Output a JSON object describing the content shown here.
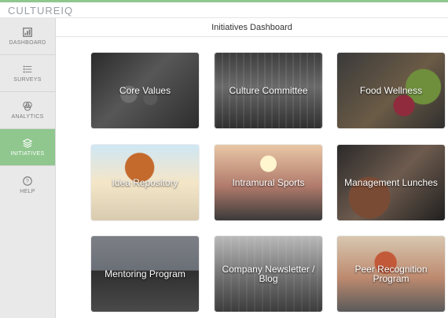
{
  "app": {
    "logo_text": "CULTUREIQ",
    "accent_color": "#8fc78f"
  },
  "sidebar": {
    "items": [
      {
        "label": "DASHBOARD",
        "icon": "dashboard-icon",
        "active": false
      },
      {
        "label": "SURVEYS",
        "icon": "list-icon",
        "active": false
      },
      {
        "label": "ANALYTICS",
        "icon": "venn-icon",
        "active": false
      },
      {
        "label": "INITIATIVES",
        "icon": "stack-icon",
        "active": true
      },
      {
        "label": "HELP",
        "icon": "help-icon",
        "active": false
      }
    ]
  },
  "header": {
    "title": "Initiatives Dashboard"
  },
  "initiatives": [
    {
      "label": "Core Values"
    },
    {
      "label": "Culture Committee"
    },
    {
      "label": "Food Wellness"
    },
    {
      "label": "Idea Repository"
    },
    {
      "label": "Intramural Sports"
    },
    {
      "label": "Management Lunches"
    },
    {
      "label": "Mentoring Program"
    },
    {
      "label": "Company Newsletter / Blog"
    },
    {
      "label": "Peer Recognition Program"
    }
  ]
}
